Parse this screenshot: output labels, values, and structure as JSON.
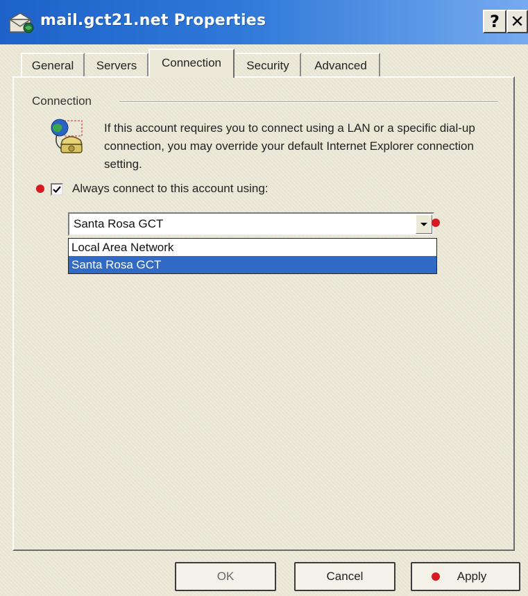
{
  "window": {
    "title": "mail.gct21.net Properties",
    "help_label": "?",
    "close_label": "✕",
    "icon": "mail-account-icon"
  },
  "tabs": [
    {
      "label": "General",
      "active": false
    },
    {
      "label": "Servers",
      "active": false
    },
    {
      "label": "Connection",
      "active": true
    },
    {
      "label": "Security",
      "active": false
    },
    {
      "label": "Advanced",
      "active": false
    }
  ],
  "connection": {
    "group_label": "Connection",
    "description": "If this account requires you to connect using a LAN or a specific dial-up connection, you may override your default Internet Explorer connection setting.",
    "icon": "network-connection-icon",
    "checkbox_label": "Always connect to this account using:",
    "checkbox_checked": true,
    "selected_connection": "Santa Rosa GCT",
    "options": [
      "Local Area Network",
      "Santa Rosa GCT"
    ]
  },
  "buttons": {
    "ok": "OK",
    "cancel": "Cancel",
    "apply": "Apply"
  },
  "colors": {
    "title_bar": "#2f78d8",
    "selection": "#316ac5",
    "marker": "#d71921"
  }
}
